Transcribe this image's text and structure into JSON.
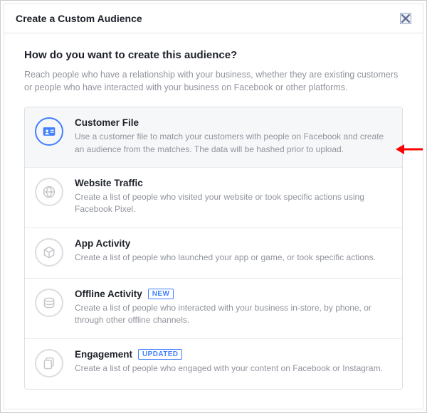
{
  "modal": {
    "title": "Create a Custom Audience",
    "question": "How do you want to create this audience?",
    "description": "Reach people who have a relationship with your business, whether they are existing customers or people who have interacted with your business on Facebook or other platforms."
  },
  "options": [
    {
      "icon": "id-card-icon",
      "title": "Customer File",
      "badge": null,
      "description": "Use a customer file to match your customers with people on Facebook and create an audience from the matches. The data will be hashed prior to upload.",
      "selected": true
    },
    {
      "icon": "globe-icon",
      "title": "Website Traffic",
      "badge": null,
      "description": "Create a list of people who visited your website or took specific actions using Facebook Pixel.",
      "selected": false
    },
    {
      "icon": "cube-icon",
      "title": "App Activity",
      "badge": null,
      "description": "Create a list of people who launched your app or game, or took specific actions.",
      "selected": false
    },
    {
      "icon": "stack-icon",
      "title": "Offline Activity",
      "badge": "NEW",
      "description": "Create a list of people who interacted with your business in-store, by phone, or through other offline channels.",
      "selected": false
    },
    {
      "icon": "copy-icon",
      "title": "Engagement",
      "badge": "UPDATED",
      "description": "Create a list of people who engaged with your content on Facebook or Instagram.",
      "selected": false
    }
  ]
}
